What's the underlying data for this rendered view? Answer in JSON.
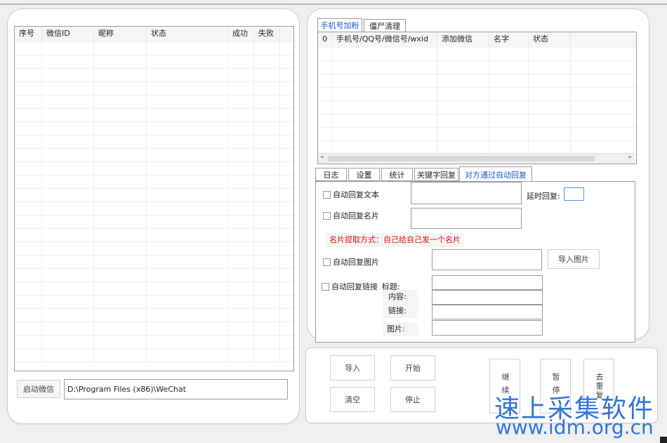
{
  "left_table": {
    "headers": [
      "序号",
      "微信ID",
      "昵称",
      "状态",
      "成功",
      "失败"
    ]
  },
  "wechat": {
    "launch_label": "启动微信",
    "path_value": "D:\\Program Files (x86)\\WeChat"
  },
  "top_tabs": [
    {
      "label": "手机号加粉"
    },
    {
      "label": "僵尸清理"
    }
  ],
  "right_table": {
    "headers": [
      "0",
      "手机号/QQ号/微信号/wxid",
      "添加微信",
      "名字",
      "状态"
    ]
  },
  "bottom_tabs": [
    {
      "label": "日志"
    },
    {
      "label": "设置"
    },
    {
      "label": "统计"
    },
    {
      "label": "关键字回复"
    },
    {
      "label": "对方通过自动回复"
    }
  ],
  "auto_reply": {
    "text_label": "自动回复文本",
    "delay_label": "延时回复:",
    "delay_value": "",
    "card_label": "自动回复名片",
    "card_hint": "名片提取方式：自己给自己发一个名片",
    "image_label": "自动回复图片",
    "import_image_label": "导入图片",
    "link_label": "自动回复链接",
    "title_label": "标题:",
    "content_label": "内容:",
    "link_field_label": "链接:",
    "picture_label": "图片:"
  },
  "actions": {
    "import_label": "导入",
    "start_label": "开始",
    "clear_label": "清空",
    "stop_label": "停止",
    "continue_label": "继续",
    "pause_label": "暂停",
    "dedupe_label": "去重复"
  },
  "watermark": {
    "line1": "速上采集软件",
    "line2": "www.idm.org.cn"
  },
  "colors": {
    "active_tab_text": "#1a56c8",
    "hint_red": "#e01010",
    "watermark": "#2f73d8"
  }
}
